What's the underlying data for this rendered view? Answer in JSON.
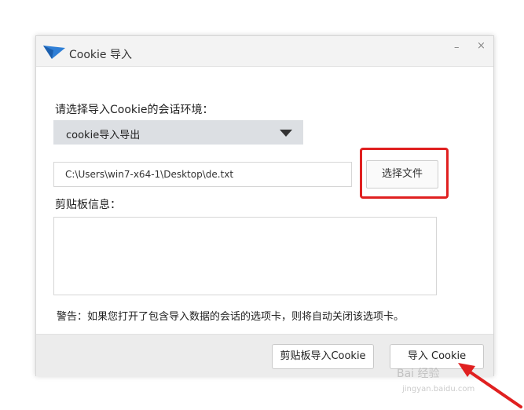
{
  "window": {
    "title": "Cookie 导入",
    "minimize_glyph": "–",
    "close_glyph": "×",
    "icon": "app-bird-icon",
    "accent_color": "#2f7fd6"
  },
  "form": {
    "env_label": "请选择导入Cookie的会话环境：",
    "env_selected": "cookie导入导出",
    "file_path": "C:\\Users\\win7-x64-1\\Desktop\\de.txt",
    "choose_file_label": "选择文件",
    "clipboard_label": "剪贴板信息：",
    "clipboard_value": "",
    "warning": "警告：如果您打开了包含导入数据的会话的选项卡，则将自动关闭该选项卡。"
  },
  "footer": {
    "clipboard_import_label": "剪贴板导入Cookie",
    "import_label": "导入 Cookie"
  },
  "annotation": {
    "highlight_color": "#e02020"
  },
  "watermark": {
    "text": "Bai 经验",
    "sub": "jingyan.baidu.com"
  }
}
